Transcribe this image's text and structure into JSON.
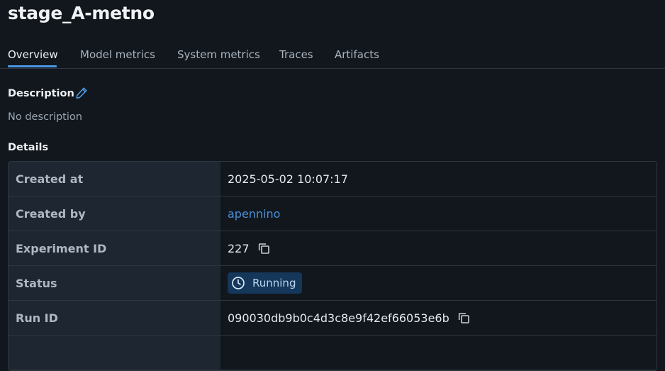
{
  "header": {
    "title": "stage_A-metno"
  },
  "tabs": [
    {
      "label": "Overview",
      "active": true
    },
    {
      "label": "Model metrics",
      "active": false
    },
    {
      "label": "System metrics",
      "active": false
    },
    {
      "label": "Traces",
      "active": false
    },
    {
      "label": "Artifacts",
      "active": false
    }
  ],
  "description": {
    "heading": "Description",
    "edit_icon": "pencil-icon",
    "text": "No description"
  },
  "details": {
    "heading": "Details",
    "rows": [
      {
        "key": "Created at",
        "value": "2025-05-02 10:07:17"
      },
      {
        "key": "Created by",
        "value": "apennino"
      },
      {
        "key": "Experiment ID",
        "value": "227"
      },
      {
        "key": "Status",
        "value": "Running"
      },
      {
        "key": "Run ID",
        "value": "090030db9b0c4d3c8e9f42ef66053e6b"
      }
    ]
  },
  "colors": {
    "background": "#11171d",
    "accent": "#4c97e2",
    "link": "#4a8fd8",
    "key_cell_bg": "#1e2731",
    "running_badge_bg": "#14375a"
  },
  "icons": {
    "copy": "copy-icon",
    "status_running": "clock-icon"
  }
}
